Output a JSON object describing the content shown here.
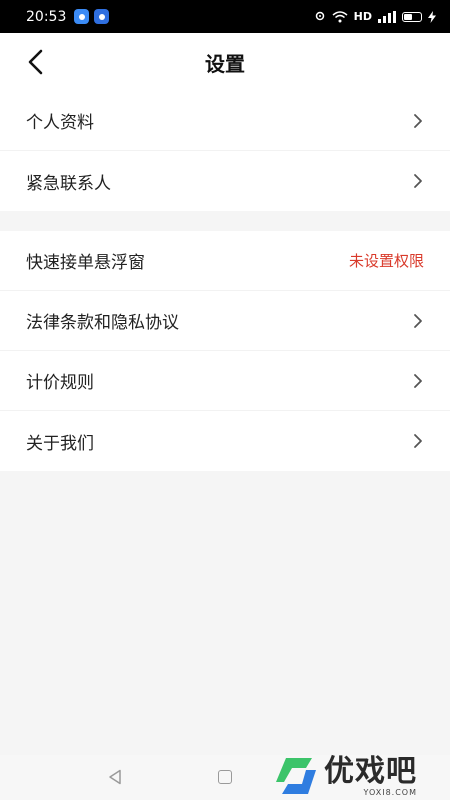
{
  "status_bar": {
    "time": "20:53",
    "hd": "HD",
    "signal": "4G"
  },
  "header": {
    "title": "设置"
  },
  "settings": {
    "group1": [
      {
        "label": "个人资料"
      },
      {
        "label": "紧急联系人"
      }
    ],
    "group2": [
      {
        "label": "快速接单悬浮窗",
        "status": "未设置权限"
      },
      {
        "label": "法律条款和隐私协议"
      },
      {
        "label": "计价规则"
      },
      {
        "label": "关于我们"
      }
    ]
  },
  "watermark": {
    "brand": "优戏吧",
    "domain": "YOXI8.COM"
  },
  "colors": {
    "status_warning": "#d93a2b",
    "background": "#f5f5f5",
    "watermark_green": "#3cc46a",
    "watermark_blue": "#2f7de0"
  }
}
